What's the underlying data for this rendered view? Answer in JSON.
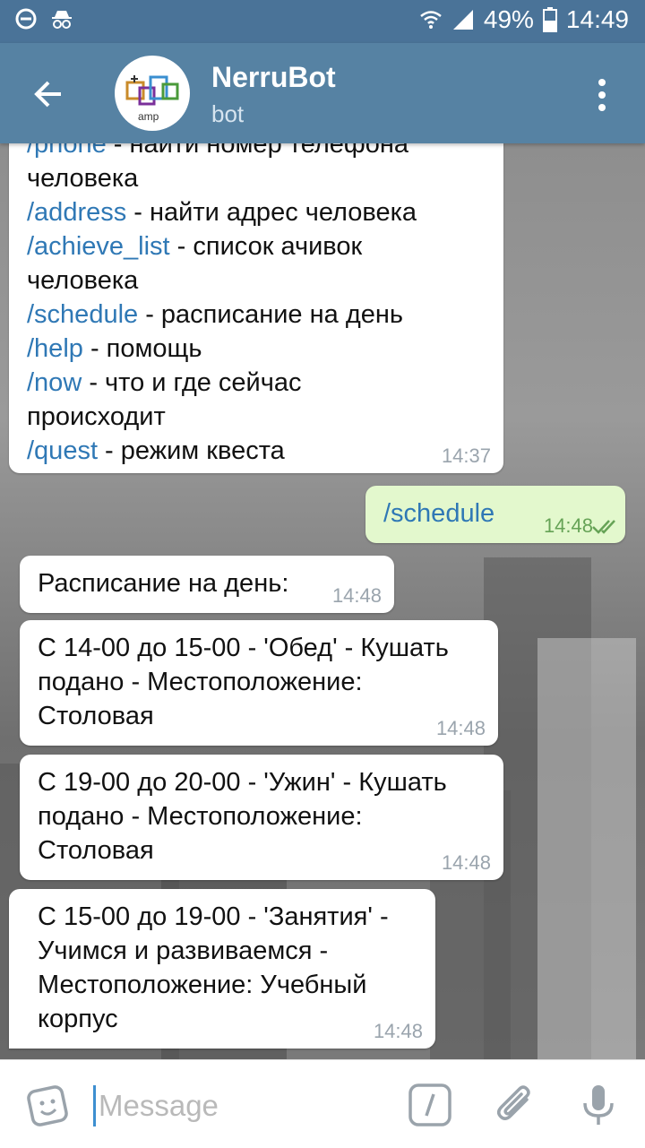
{
  "status_bar": {
    "battery": "49%",
    "time": "14:49"
  },
  "header": {
    "title": "NerruBot",
    "subtitle": "bot",
    "avatar_text": "amp"
  },
  "messages": [
    {
      "id": "m1",
      "cut_line": "/phone - найти номер телефона"
    },
    {
      "id": "m1b",
      "lines": [
        {
          "plain": "человека"
        },
        {
          "cmd": "/address",
          "text": " - найти адрес человека"
        },
        {
          "cmd": "/achieve_list",
          "text": " - список ачивок"
        },
        {
          "plain": "человека"
        },
        {
          "cmd": "/schedule",
          "text": " - расписание на день"
        },
        {
          "cmd": "/help",
          "text": " - помощь"
        },
        {
          "cmd": "/now",
          "text": " - что и где сейчас"
        },
        {
          "plain": "происходит"
        },
        {
          "cmd": "/quest",
          "text": " - режим квеста"
        }
      ],
      "time": "14:37"
    },
    {
      "id": "m2",
      "text": "/schedule",
      "time": "14:48"
    },
    {
      "id": "m3",
      "text": "Расписание на день:",
      "time": "14:48"
    },
    {
      "id": "m4",
      "line1": "С 14-00 до 15-00 - 'Обед' - Кушать",
      "line2": "подано - Местоположение:",
      "line3": "Столовая",
      "time": "14:48"
    },
    {
      "id": "m5",
      "line1": "С 19-00 до 20-00 - 'Ужин' - Кушать",
      "line2": "подано - Местоположение:",
      "line3": "Столовая",
      "time": "14:48"
    },
    {
      "id": "m6",
      "line1": "С 15-00 до 19-00 - 'Занятия' -",
      "line2": "Учимся и развиваемся -",
      "line3": "Местоположение: Учебный",
      "line4": "корпус",
      "time": "14:48"
    }
  ],
  "input": {
    "placeholder": "Message"
  },
  "colors": {
    "status_bar": "#4a7398",
    "app_bar": "#5682a3",
    "command_link": "#2f78b5",
    "outgoing_bubble": "#e3f8cd"
  }
}
